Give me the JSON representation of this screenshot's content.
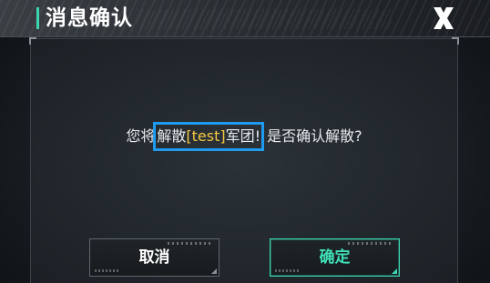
{
  "dialog": {
    "title": "消息确认",
    "close_icon": "close-x-icon"
  },
  "message": {
    "prefix": "您将",
    "action": "解散",
    "name": "[test]",
    "suffix": "军团!",
    "question": " 是否确认解散?"
  },
  "buttons": {
    "cancel_label": "取消",
    "confirm_label": "确定"
  },
  "colors": {
    "accent": "#3bd6b0",
    "highlight_box": "#1e9bf0",
    "name_text": "#f5c842"
  }
}
